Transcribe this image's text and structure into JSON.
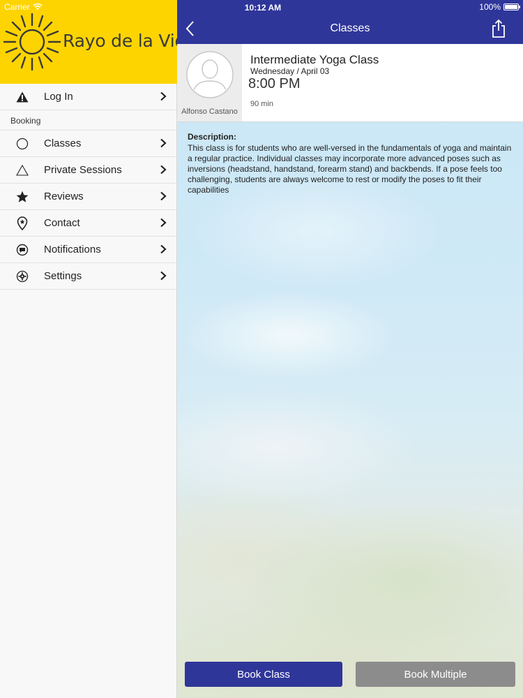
{
  "status_bar": {
    "carrier": "Carrier",
    "time": "10:12 AM",
    "battery": "100%"
  },
  "sidebar": {
    "brand": "Rayo de la Vida",
    "brand_color": "#fdd400",
    "login": {
      "label": "Log In",
      "icon": "warning-icon"
    },
    "section": "Booking",
    "items": [
      {
        "label": "Classes",
        "icon": "circle-icon"
      },
      {
        "label": "Private Sessions",
        "icon": "triangle-icon"
      },
      {
        "label": "Reviews",
        "icon": "star-icon"
      },
      {
        "label": "Contact",
        "icon": "location-pin-icon"
      },
      {
        "label": "Notifications",
        "icon": "chat-bubble-icon"
      },
      {
        "label": "Settings",
        "icon": "gear-icon"
      }
    ]
  },
  "navbar": {
    "title": "Classes",
    "color": "#2f3699"
  },
  "class_detail": {
    "title": "Intermediate Yoga Class",
    "date": "Wednesday / April 03",
    "time": "8:00 PM",
    "duration": "90 min",
    "instructor": "Alfonso Castano",
    "description_label": "Description:",
    "description": "This class is for students who are well-versed in the fundamentals of yoga and maintain a regular practice. Individual classes may incorporate more advanced poses such as inversions (headstand, handstand, forearm stand) and backbends. If a pose feels too challenging, students are always welcome to rest or modify the poses to fit their capabilities"
  },
  "actions": {
    "book_class": "Book Class",
    "book_multiple": "Book Multiple",
    "book_class_color": "#2f3699",
    "book_multiple_color": "#8c8c8c"
  }
}
